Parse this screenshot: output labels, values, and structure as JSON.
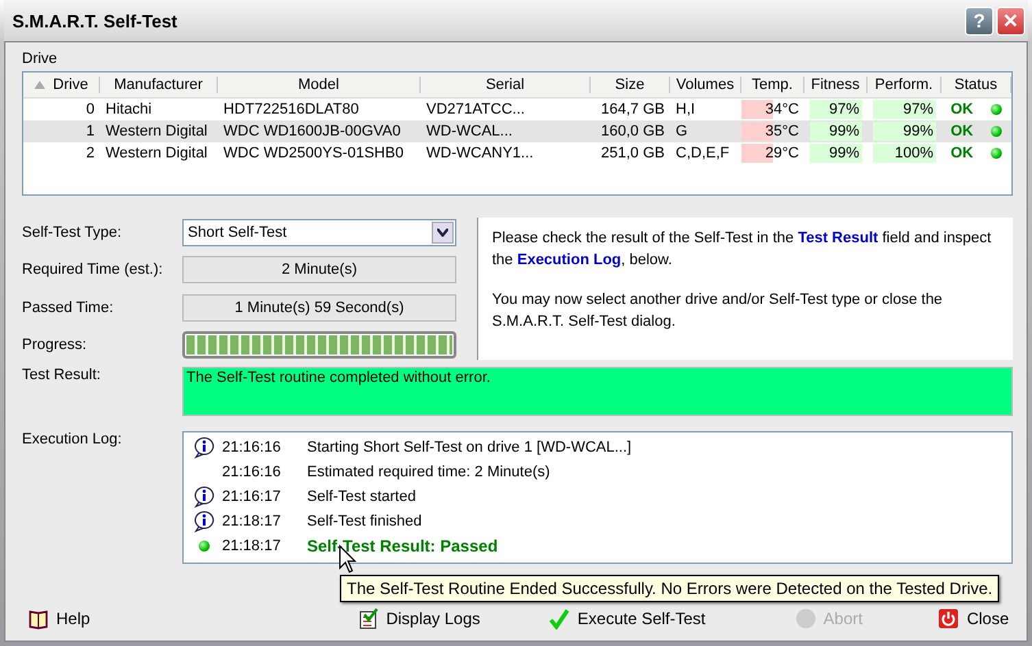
{
  "window": {
    "title": "S.M.A.R.T. Self-Test",
    "buttons": [
      "?",
      "✕"
    ]
  },
  "drive_group": {
    "label": "Drive"
  },
  "table": {
    "columns": [
      "Drive",
      "Manufacturer",
      "Model",
      "Serial",
      "Size",
      "Volumes",
      "Temp.",
      "Fitness",
      "Perform.",
      "Status"
    ],
    "rows": [
      {
        "cells": [
          "0",
          "Hitachi",
          "HDT722516DLAT80",
          "VD271ATCC...",
          "164,7 GB",
          "H,I",
          "34°C",
          "97%",
          "97%",
          "OK"
        ],
        "selected": false
      },
      {
        "cells": [
          "1",
          "Western Digital",
          "WDC WD1600JB-00GVA0",
          "WD-WCAL...",
          "160,0 GB",
          "G",
          "35°C",
          "99%",
          "99%",
          "OK"
        ],
        "selected": true
      },
      {
        "cells": [
          "2",
          "Western Digital",
          "WDC WD2500YS-01SHB0",
          "WD-WCANY1...",
          "251,0 GB",
          "C,D,E,F",
          "29°C",
          "99%",
          "100%",
          "OK"
        ],
        "selected": false
      }
    ]
  },
  "form": {
    "self_test_type": {
      "label": "Self-Test Type:",
      "value": "Short Self-Test"
    },
    "required_time": {
      "label": "Required Time (est.):",
      "value": "2 Minute(s)"
    },
    "passed_time": {
      "label": "Passed Time:",
      "value": "1 Minute(s) 59 Second(s)"
    },
    "progress": {
      "label": "Progress:",
      "level": 1
    }
  },
  "info": [
    "Please check the result of the Self-Test in the **Test Result** field and inspect the **Execution Log**, below.",
    "You may now select another drive and/or Self-Test type or close the S.M.A.R.T. Self-Test dialog."
  ],
  "test_result": {
    "label": "Test Result:",
    "value": "The Self-Test routine completed without error."
  },
  "execution_log": {
    "label": "Execution Log:",
    "entries": [
      {
        "kind": "info",
        "time": "21:16:16",
        "message": "Starting Short Self-Test on drive 1 [WD-WCAL...]"
      },
      {
        "kind": "plain",
        "time": "21:16:16",
        "message": "Estimated required time: 2 Minute(s)"
      },
      {
        "kind": "info",
        "time": "21:16:17",
        "message": "Self-Test started"
      },
      {
        "kind": "info",
        "time": "21:18:17",
        "message": "Self-Test finished"
      },
      {
        "kind": "success",
        "time": "21:18:17",
        "message": "Self-Test Result: Passed"
      }
    ]
  },
  "tooltip": "The Self-Test Routine Ended Successfully. No Errors were Detected on the Tested Drive.",
  "buttons": [
    {
      "kind": "help",
      "label": "Help",
      "disabled": false
    },
    {
      "kind": "logs",
      "label": "Display Logs",
      "disabled": false
    },
    {
      "kind": "execute",
      "label": "Execute Self-Test",
      "disabled": false
    },
    {
      "kind": "abort",
      "label": "Abort",
      "disabled": true
    },
    {
      "kind": "close",
      "label": "Close",
      "disabled": false
    }
  ]
}
